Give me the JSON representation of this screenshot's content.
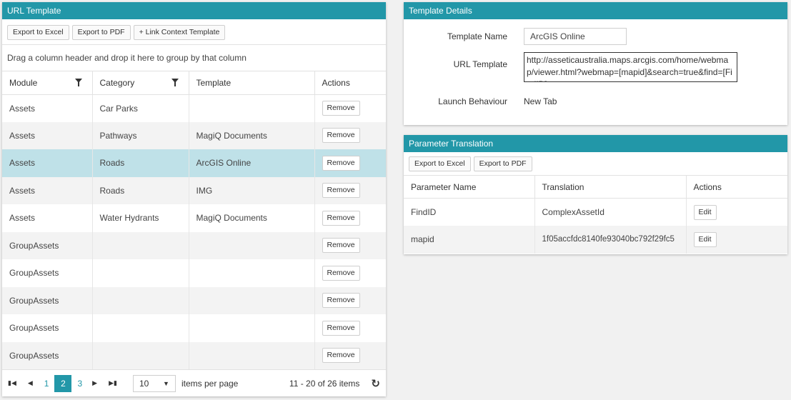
{
  "url_template": {
    "title": "URL Template",
    "toolbar": {
      "export_excel": "Export to Excel",
      "export_pdf": "Export to PDF",
      "link_context": "+ Link Context Template"
    },
    "group_hint": "Drag a column header and drop it here to group by that column",
    "columns": {
      "module": "Module",
      "category": "Category",
      "template": "Template",
      "actions": "Actions"
    },
    "rows": [
      {
        "module": "Assets",
        "category": "Car Parks",
        "template": "",
        "action": "Remove"
      },
      {
        "module": "Assets",
        "category": "Pathways",
        "template": "MagiQ Documents",
        "action": "Remove"
      },
      {
        "module": "Assets",
        "category": "Roads",
        "template": "ArcGIS Online",
        "action": "Remove"
      },
      {
        "module": "Assets",
        "category": "Roads",
        "template": "IMG",
        "action": "Remove"
      },
      {
        "module": "Assets",
        "category": "Water Hydrants",
        "template": "MagiQ Documents",
        "action": "Remove"
      },
      {
        "module": "GroupAssets",
        "category": "",
        "template": "",
        "action": "Remove"
      },
      {
        "module": "GroupAssets",
        "category": "",
        "template": "",
        "action": "Remove"
      },
      {
        "module": "GroupAssets",
        "category": "",
        "template": "",
        "action": "Remove"
      },
      {
        "module": "GroupAssets",
        "category": "",
        "template": "",
        "action": "Remove"
      },
      {
        "module": "GroupAssets",
        "category": "",
        "template": "",
        "action": "Remove"
      }
    ],
    "pager": {
      "pages": [
        "1",
        "2",
        "3"
      ],
      "current_page": "2",
      "page_size": "10",
      "items_per_page_label": "items per page",
      "info": "11 - 20 of 26 items"
    },
    "colors": {
      "header": "#2297a8",
      "selected_row": "#bfe1e8"
    }
  },
  "template_details": {
    "title": "Template Details",
    "name_label": "Template Name",
    "name_value": "ArcGIS Online",
    "url_label": "URL Template",
    "url_value": "http://asseticaustralia.maps.arcgis.com/home/webmap/viewer.html?webmap=[mapid]&search=true&find=[FindID]",
    "launch_label": "Launch Behaviour",
    "launch_value": "New Tab"
  },
  "parameter_translation": {
    "title": "Parameter Translation",
    "toolbar": {
      "export_excel": "Export to Excel",
      "export_pdf": "Export to PDF"
    },
    "columns": {
      "name": "Parameter Name",
      "translation": "Translation",
      "actions": "Actions"
    },
    "rows": [
      {
        "name": "FindID",
        "translation": "ComplexAssetId",
        "action": "Edit"
      },
      {
        "name": "mapid",
        "translation": "1f05accfdc8140fe93040bc792f29fc5",
        "action": "Edit"
      }
    ]
  }
}
